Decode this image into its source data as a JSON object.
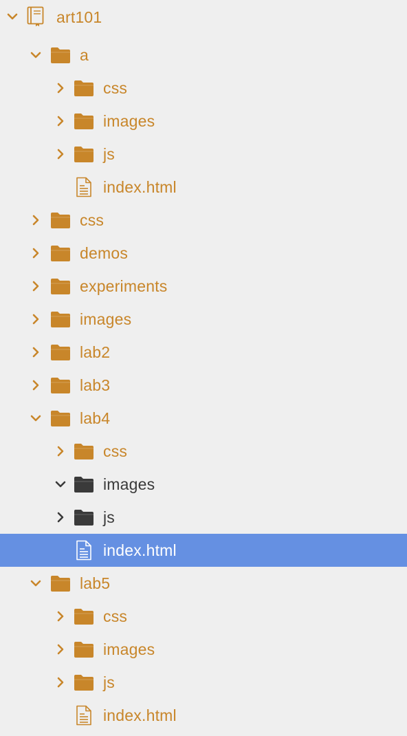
{
  "colors": {
    "background": "#efefef",
    "accent": "#c8862a",
    "dark": "#3a3a3a",
    "selected_row": "#6590e2",
    "selected_text": "#ffffff"
  },
  "file_tree": {
    "root": {
      "label": "art101",
      "icon": "project-book-icon",
      "expanded": true
    },
    "items": [
      {
        "label": "a",
        "type": "folder",
        "depth": 1,
        "expanded": true,
        "tone": "accent"
      },
      {
        "label": "css",
        "type": "folder",
        "depth": 2,
        "expanded": false,
        "tone": "accent"
      },
      {
        "label": "images",
        "type": "folder",
        "depth": 2,
        "expanded": false,
        "tone": "accent"
      },
      {
        "label": "js",
        "type": "folder",
        "depth": 2,
        "expanded": false,
        "tone": "accent"
      },
      {
        "label": "index.html",
        "type": "file",
        "depth": 2,
        "tone": "accent"
      },
      {
        "label": "css",
        "type": "folder",
        "depth": 1,
        "expanded": false,
        "tone": "accent"
      },
      {
        "label": "demos",
        "type": "folder",
        "depth": 1,
        "expanded": false,
        "tone": "accent"
      },
      {
        "label": "experiments",
        "type": "folder",
        "depth": 1,
        "expanded": false,
        "tone": "accent"
      },
      {
        "label": "images",
        "type": "folder",
        "depth": 1,
        "expanded": false,
        "tone": "accent"
      },
      {
        "label": "lab2",
        "type": "folder",
        "depth": 1,
        "expanded": false,
        "tone": "accent"
      },
      {
        "label": "lab3",
        "type": "folder",
        "depth": 1,
        "expanded": false,
        "tone": "accent"
      },
      {
        "label": "lab4",
        "type": "folder",
        "depth": 1,
        "expanded": true,
        "tone": "accent"
      },
      {
        "label": "css",
        "type": "folder",
        "depth": 2,
        "expanded": false,
        "tone": "accent"
      },
      {
        "label": "images",
        "type": "folder",
        "depth": 2,
        "expanded": true,
        "tone": "dark"
      },
      {
        "label": "js",
        "type": "folder",
        "depth": 2,
        "expanded": false,
        "tone": "dark"
      },
      {
        "label": "index.html",
        "type": "file",
        "depth": 2,
        "tone": "selected",
        "selected": true
      },
      {
        "label": "lab5",
        "type": "folder",
        "depth": 1,
        "expanded": true,
        "tone": "accent"
      },
      {
        "label": "css",
        "type": "folder",
        "depth": 2,
        "expanded": false,
        "tone": "accent"
      },
      {
        "label": "images",
        "type": "folder",
        "depth": 2,
        "expanded": false,
        "tone": "accent"
      },
      {
        "label": "js",
        "type": "folder",
        "depth": 2,
        "expanded": false,
        "tone": "accent"
      },
      {
        "label": "index.html",
        "type": "file",
        "depth": 2,
        "tone": "accent"
      }
    ]
  }
}
